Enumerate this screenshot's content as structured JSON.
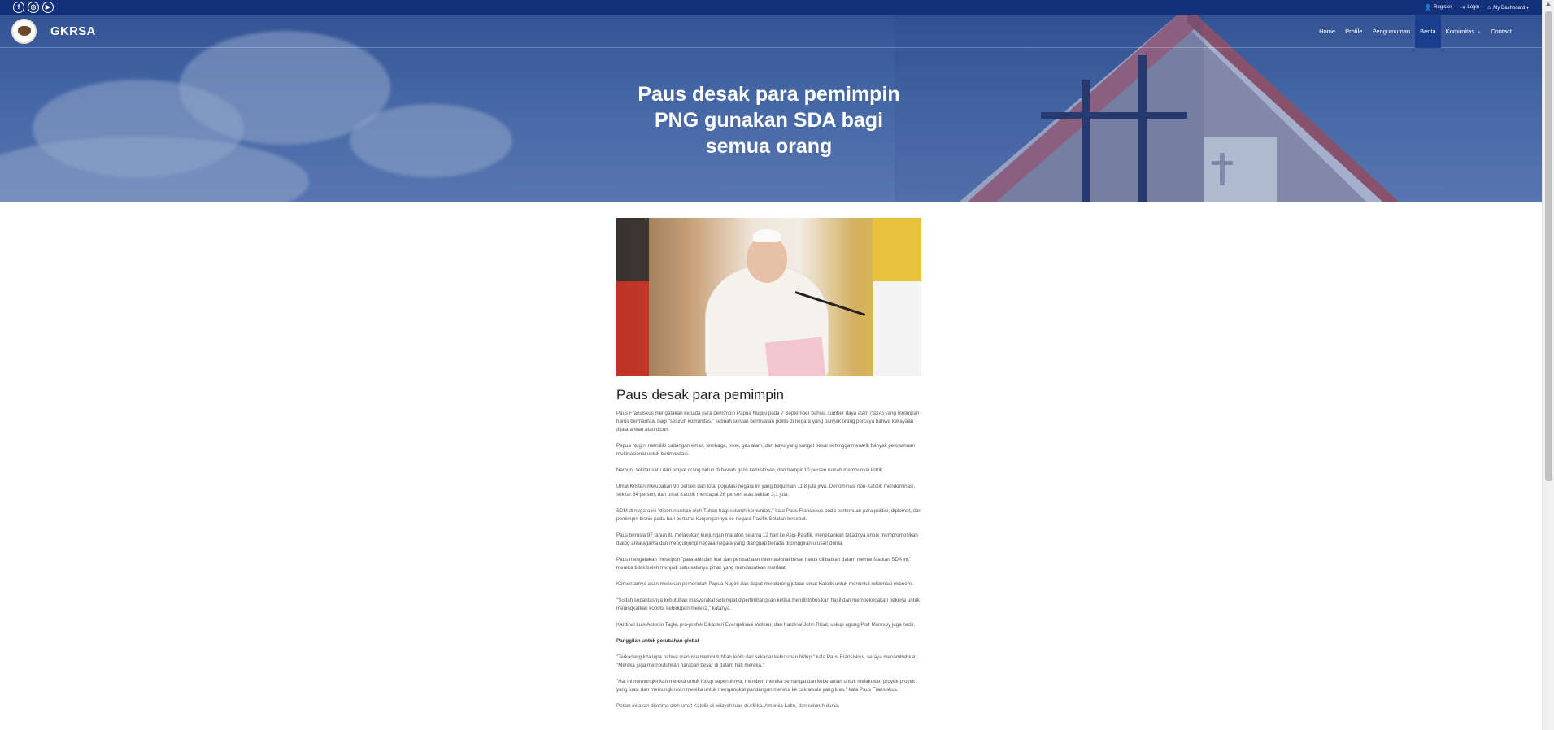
{
  "topbar": {
    "social": [
      {
        "icon": "facebook-icon",
        "glyph": "f"
      },
      {
        "icon": "instagram-icon",
        "glyph": "◎"
      },
      {
        "icon": "youtube-icon",
        "glyph": "▶"
      }
    ],
    "user_links": [
      {
        "icon": "user-plus-icon",
        "glyph": "👤",
        "label": "Register"
      },
      {
        "icon": "login-icon",
        "glyph": "⇥",
        "label": "Login"
      },
      {
        "icon": "home-icon",
        "glyph": "⌂",
        "label": "My Dashboard ▾"
      }
    ]
  },
  "navbar": {
    "brand_name": "GKRSA",
    "menu": [
      {
        "label": "Home",
        "active": false
      },
      {
        "label": "Profile",
        "active": false
      },
      {
        "label": "Pengumuman",
        "active": false
      },
      {
        "label": "Berita",
        "active": true
      },
      {
        "label": "Komunitas",
        "active": false,
        "dropdown": true
      },
      {
        "label": "Contact",
        "active": false
      }
    ]
  },
  "hero": {
    "title_lines": [
      "Paus desak para pemimpin",
      "PNG gunakan SDA bagi",
      "semua orang"
    ]
  },
  "article": {
    "title": "Paus desak para pemimpin",
    "paragraphs": [
      "Paus Fransiskus mengatakan kepada para pemimpin Papua Nugini pada 7 September bahwa sumber daya alam (SDA) yang melimpah harus bermanfaat bagi \"seluruh komunitas,\" sebuah seruan bermuatan politis di negara yang banyak orang percaya bahwa kekayaan dijalarahkan atau dicuri.",
      "Papua Nugini memiliki cadangan emas, tembaga, nikel, gas alam, dan kayu yang sangat besar sehingga menarik banyak perusahaan multinasional untuk berinvestasi.",
      "Namun, sekitar satu dari empat orang hidup di bawah garis kemiskinan, dan hampir 10 persen rumah mempunyai listrik.",
      "Umat Kristen merupakan 90 persen dari total populasi negara ini yang berjumlah 11,8 juta jiwa. Denominasi non-Katolik mendominasi, sekitar 64 persen, dan umat Katolik mencapai 26 persen atau sekitar 3,1 juta.",
      "SDM di negara ini \"diperuntukkan oleh Tuhan bagi seluruh komunitas,\" kata Paus Fransiskus pada pertemuan para politisi, diplomat, dan pemimpin bisnis pada hari pertama kunjungannya ke negara Pasifik Selatan tersebut.",
      "Paus berusia 87 tahun itu melakukan kunjungan maraton selama 12 hari ke Asia-Pasifik, menekankan tekadnya untuk mempromosikan dialog antaragama dan mengunjungi negara-negara yang dianggap berada di pinggiran urusan dunia.",
      "Paus mengatakan meskipun \"para ahli dari luar dan perusahaan internasional besar harus dilibatkan dalam memanfaatkan SDA ini,\" mereka tidak boleh menjadi satu-satunya pihak yang mendapatkan manfaat.",
      "Komentarnya akan menekan pemerintah Papua Nugini dan dapat mendorong jutaan umat Katolik untuk menuntut reformasi ekonomi.",
      "\"Sudah sepantasnya kebutuhan masyarakat setempat dipertimbangkan ketika mendistribusikan hasil dan mempekerjakan pekerja untuk meningkatkan kondisi kehidupan mereka,\" katanya.",
      "Kardinal Luis Antonio Tagle, pro-prefek Dikasteri Evangelisasi Vatikan, dan Kardinal John Ribat, uskup agung Port Moresby juga hadir."
    ],
    "subheading": "Panggilan untuk perubahan global",
    "paragraphs_after": [
      "\"Terkadang kita lupa bahwa manusia membutuhkan lebih dari sekadar kebutuhan hidup,\" kata Paus Fransiskus, seraya menambahkan: \"Mereka juga membutuhkan harapan besar di dalam hati mereka.\"",
      "\"Hal ini memungkinkan mereka untuk hidup sepenuhnya, memberi mereka semangat dan keberanian untuk melakukan proyek-proyek yang luas, dan memungkinkan mereka untuk mengangkat pandangan mereka ke cakrawala yang luas,\" kata Paus Fransiskus.",
      "Pesan ini akan diterima oleh umat Katolik di wilayah luas di Afrika, Amerika Latin, dan seluruh dunia."
    ]
  }
}
